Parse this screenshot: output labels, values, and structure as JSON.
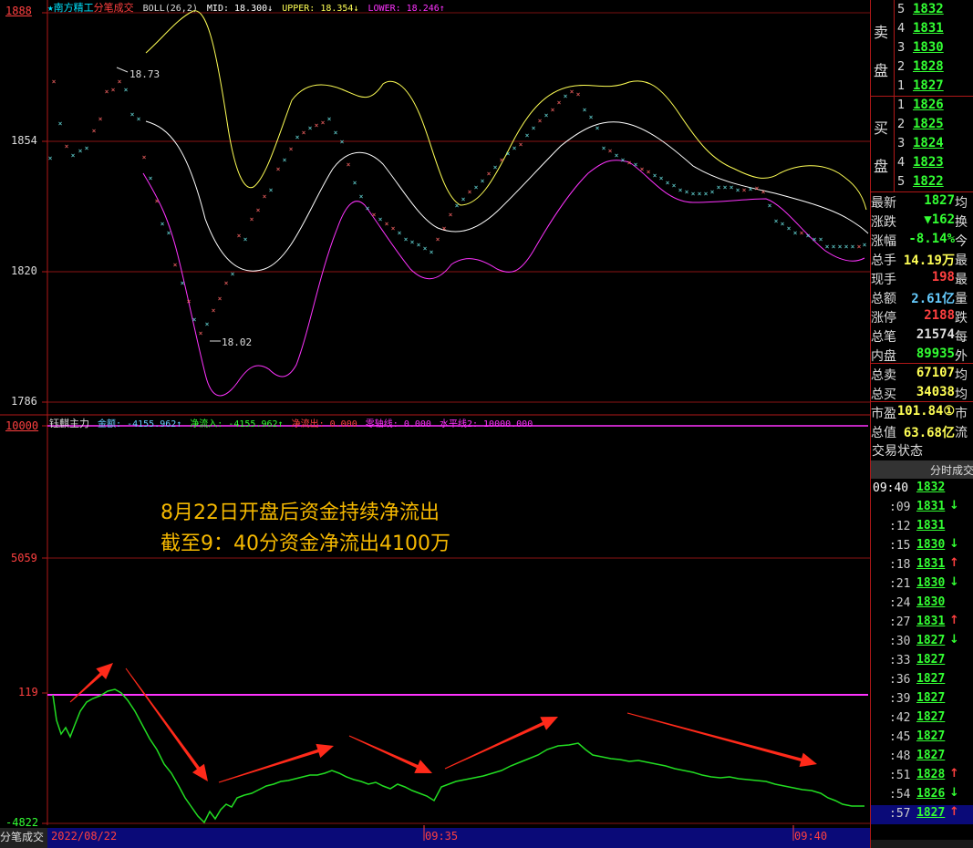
{
  "header": {
    "star": "★",
    "stock_name": "南方精工",
    "tab": "分笔成交",
    "boll": "BOLL(26,2)",
    "mid": "MID: 18.300↓",
    "upper": "UPPER: 18.354↓",
    "lower": "LOWER: 18.246↑"
  },
  "price_axis": {
    "ticks": [
      "1888",
      "1854",
      "1820",
      "1786"
    ]
  },
  "annotations": {
    "high": "18.73",
    "low": "18.02"
  },
  "indicator_header": {
    "name": "钰麒主力",
    "amount": "金额: -4155.962↑",
    "net_in": "净流入: -4155.962↑",
    "net_out": "净流出: 0.000",
    "zero_line": "零轴线: 0.000",
    "level_line": "水平线2: 10000.000"
  },
  "flow_axis": {
    "ticks": [
      "10000",
      "5059",
      "119",
      "-4822"
    ]
  },
  "overlay": {
    "line1": "8月22日开盘后资金持续净流出",
    "line2": "截至9：40分资金净流出4100万"
  },
  "time_axis": {
    "corner": "分笔成交",
    "date": "2022/08/22",
    "t1": "09:35",
    "t2": "09:40"
  },
  "order_book": {
    "sell_label": [
      "卖",
      "盘"
    ],
    "buy_label": [
      "买",
      "盘"
    ],
    "sells": [
      {
        "level": "5",
        "price": "1832"
      },
      {
        "level": "4",
        "price": "1831"
      },
      {
        "level": "3",
        "price": "1830"
      },
      {
        "level": "2",
        "price": "1828"
      },
      {
        "level": "1",
        "price": "1827"
      }
    ],
    "buys": [
      {
        "level": "1",
        "price": "1826"
      },
      {
        "level": "2",
        "price": "1825"
      },
      {
        "level": "3",
        "price": "1824"
      },
      {
        "level": "4",
        "price": "1823"
      },
      {
        "level": "5",
        "price": "1822"
      }
    ]
  },
  "stats": [
    {
      "k": "最新",
      "v": "1827",
      "k2": "均",
      "color": "#33ff33"
    },
    {
      "k": "涨跌",
      "v": "▼162",
      "k2": "换",
      "color": "#33ff33"
    },
    {
      "k": "涨幅",
      "v": "-8.14%",
      "k2": "今",
      "color": "#33ff33"
    },
    {
      "k": "总手",
      "v": "14.19万",
      "k2": "最",
      "color": "#ffff55"
    },
    {
      "k": "现手",
      "v": "198",
      "k2": "最",
      "color": "#ff4040"
    },
    {
      "k": "总额",
      "v": "2.61亿",
      "k2": "量",
      "color": "#66ccff"
    },
    {
      "k": "涨停",
      "v": "2188",
      "k2": "跌",
      "color": "#ff4040"
    },
    {
      "k": "总笔",
      "v": "21574",
      "k2": "每",
      "color": "#dddddd"
    },
    {
      "k": "内盘",
      "v": "89935",
      "k2": "外",
      "color": "#33ff33"
    },
    {
      "k": "总卖",
      "v": "67107",
      "k2": "均",
      "color": "#ffff55"
    },
    {
      "k": "总买",
      "v": "34038",
      "k2": "均",
      "color": "#ffff55"
    },
    {
      "k": "市盈",
      "v": "101.84①",
      "k2": "市",
      "color": "#ffff55"
    },
    {
      "k": "总值",
      "v": "63.68亿",
      "k2": "流",
      "color": "#ffff55"
    }
  ],
  "trade_status": "交易状态",
  "ticks_header": "分时成交",
  "ticks": [
    {
      "t": "09:40",
      "p": "1832",
      "a": ""
    },
    {
      "t": ":09",
      "p": "1831",
      "a": "↓"
    },
    {
      "t": ":12",
      "p": "1831",
      "a": ""
    },
    {
      "t": ":15",
      "p": "1830",
      "a": "↓"
    },
    {
      "t": ":18",
      "p": "1831",
      "a": "↑"
    },
    {
      "t": ":21",
      "p": "1830",
      "a": "↓"
    },
    {
      "t": ":24",
      "p": "1830",
      "a": ""
    },
    {
      "t": ":27",
      "p": "1831",
      "a": "↑"
    },
    {
      "t": ":30",
      "p": "1827",
      "a": "↓"
    },
    {
      "t": ":33",
      "p": "1827",
      "a": ""
    },
    {
      "t": ":36",
      "p": "1827",
      "a": ""
    },
    {
      "t": ":39",
      "p": "1827",
      "a": ""
    },
    {
      "t": ":42",
      "p": "1827",
      "a": ""
    },
    {
      "t": ":45",
      "p": "1827",
      "a": ""
    },
    {
      "t": ":48",
      "p": "1827",
      "a": ""
    },
    {
      "t": ":51",
      "p": "1828",
      "a": "↑"
    },
    {
      "t": ":54",
      "p": "1826",
      "a": "↓"
    },
    {
      "t": ":57",
      "p": "1827",
      "a": "↑"
    }
  ],
  "colors": {
    "up": "#ff4040",
    "down": "#33ff33",
    "mid": "#ffffff",
    "upper": "#ffff55",
    "lower": "#ff33ff",
    "flow": "#22dd22",
    "arrow": "#ff2a1a"
  }
}
